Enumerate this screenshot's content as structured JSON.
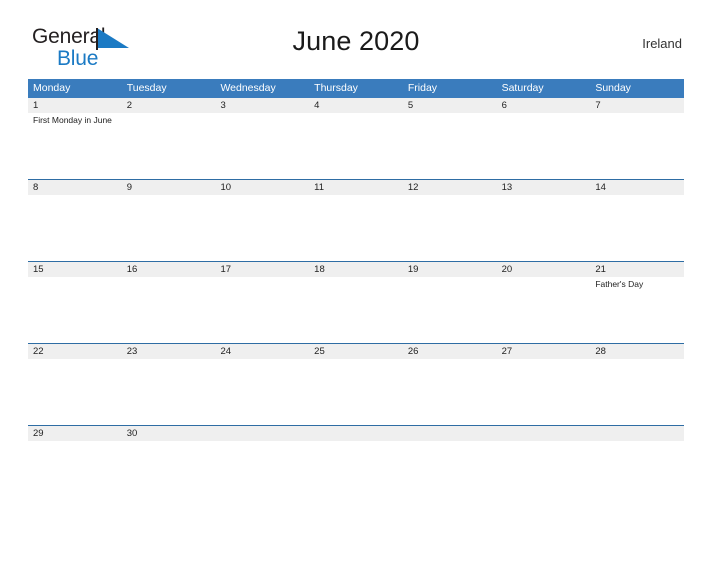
{
  "brand": {
    "name_part1": "General",
    "name_part2": "Blue",
    "flag_icon": "blue-flag-icon",
    "blue_hex": "#1b7ac4",
    "dark_hex": "#231f20"
  },
  "header": {
    "title": "June 2020",
    "country": "Ireland"
  },
  "theme": {
    "header_blue": "#3a7cbd",
    "row_rule_blue": "#2e6da4",
    "date_band_gray": "#efefef",
    "text_dark": "#222222"
  },
  "calendar": {
    "weekdays": [
      "Monday",
      "Tuesday",
      "Wednesday",
      "Thursday",
      "Friday",
      "Saturday",
      "Sunday"
    ],
    "weeks": [
      {
        "days": [
          {
            "date": "1",
            "event": "First Monday in June"
          },
          {
            "date": "2",
            "event": ""
          },
          {
            "date": "3",
            "event": ""
          },
          {
            "date": "4",
            "event": ""
          },
          {
            "date": "5",
            "event": ""
          },
          {
            "date": "6",
            "event": ""
          },
          {
            "date": "7",
            "event": ""
          }
        ]
      },
      {
        "days": [
          {
            "date": "8",
            "event": ""
          },
          {
            "date": "9",
            "event": ""
          },
          {
            "date": "10",
            "event": ""
          },
          {
            "date": "11",
            "event": ""
          },
          {
            "date": "12",
            "event": ""
          },
          {
            "date": "13",
            "event": ""
          },
          {
            "date": "14",
            "event": ""
          }
        ]
      },
      {
        "days": [
          {
            "date": "15",
            "event": ""
          },
          {
            "date": "16",
            "event": ""
          },
          {
            "date": "17",
            "event": ""
          },
          {
            "date": "18",
            "event": ""
          },
          {
            "date": "19",
            "event": ""
          },
          {
            "date": "20",
            "event": ""
          },
          {
            "date": "21",
            "event": "Father's Day"
          }
        ]
      },
      {
        "days": [
          {
            "date": "22",
            "event": ""
          },
          {
            "date": "23",
            "event": ""
          },
          {
            "date": "24",
            "event": ""
          },
          {
            "date": "25",
            "event": ""
          },
          {
            "date": "26",
            "event": ""
          },
          {
            "date": "27",
            "event": ""
          },
          {
            "date": "28",
            "event": ""
          }
        ]
      },
      {
        "days": [
          {
            "date": "29",
            "event": ""
          },
          {
            "date": "30",
            "event": ""
          },
          {
            "date": "",
            "event": ""
          },
          {
            "date": "",
            "event": ""
          },
          {
            "date": "",
            "event": ""
          },
          {
            "date": "",
            "event": ""
          },
          {
            "date": "",
            "event": ""
          }
        ]
      }
    ]
  }
}
